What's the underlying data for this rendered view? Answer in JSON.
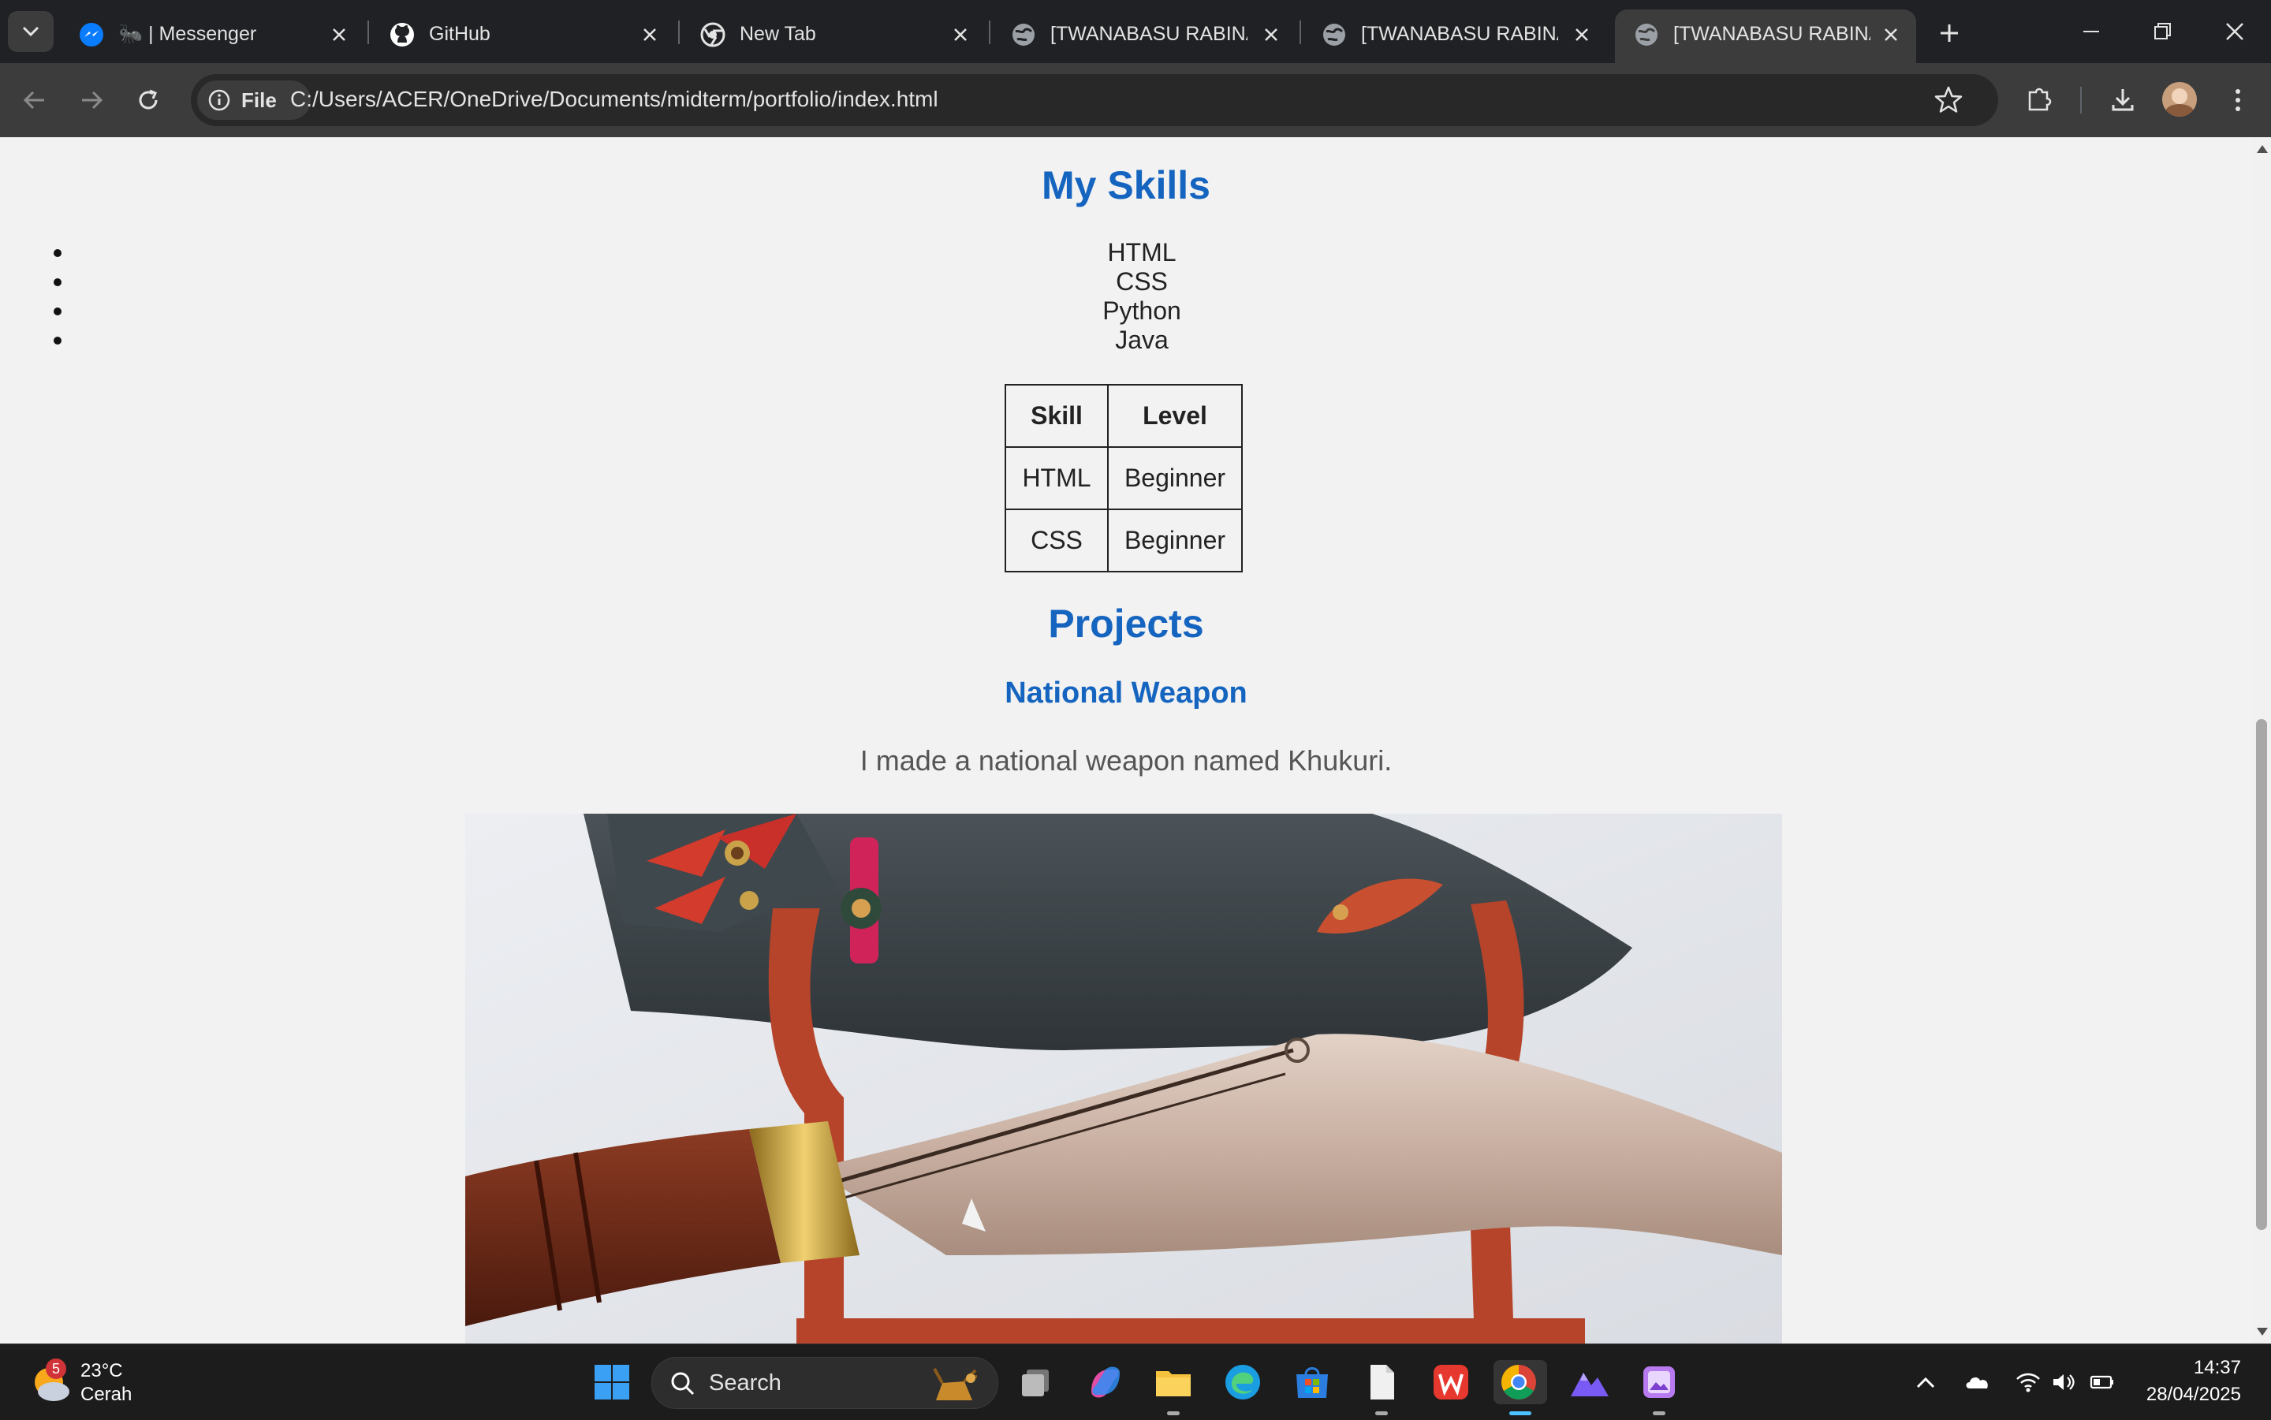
{
  "browser": {
    "tabs": [
      {
        "title": "🐜 | Messenger",
        "favicon": "messenger-icon",
        "active": false
      },
      {
        "title": "GitHub",
        "favicon": "github-icon",
        "active": false
      },
      {
        "title": "New Tab",
        "favicon": "chrome-icon",
        "active": false
      },
      {
        "title": "[TWANABASU RABINA]",
        "favicon": "globe-icon",
        "active": false
      },
      {
        "title": "[TWANABASU RABINA]",
        "favicon": "globe-icon",
        "active": false
      },
      {
        "title": "[TWANABASU RABINA]",
        "favicon": "globe-icon",
        "active": true
      }
    ],
    "file_chip": "File",
    "url": "C:/Users/ACER/OneDrive/Documents/midterm/portfolio/index.html"
  },
  "page": {
    "skills_heading": "My Skills",
    "skills": [
      "HTML",
      "CSS",
      "Python",
      "Java"
    ],
    "table": {
      "headers": [
        "Skill",
        "Level"
      ],
      "rows": [
        [
          "HTML",
          "Beginner"
        ],
        [
          "CSS",
          "Beginner"
        ]
      ]
    },
    "projects_heading": "Projects",
    "project_title": "National Weapon",
    "project_description": "I made a national weapon named Khukuri."
  },
  "taskbar": {
    "weather_badge": "5",
    "weather_temp": "23°C",
    "weather_desc": "Cerah",
    "search_label": "Search",
    "time": "14:37",
    "date": "28/04/2025"
  },
  "colors": {
    "heading": "#1565c0",
    "page_bg": "#f2f2f2",
    "chrome_dark": "#202124"
  }
}
